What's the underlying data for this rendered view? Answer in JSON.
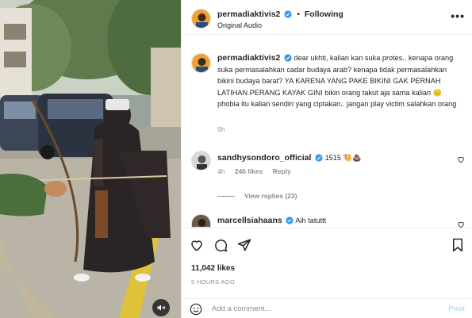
{
  "post": {
    "author": "permadiaktivis2",
    "follow_state": "Following",
    "audio_label": "Original Audio",
    "more_label": "•••",
    "caption_author": "permadiaktivis2",
    "caption_text": "dear ukhti, kalian kan suka protes.. kenapa orang suka permasalahkan cadar budaya arab? kenapa tidak permasalahkan bikini budaya barat? YA KARENA YANG PAKE BIKINI GAK PERNAH LATIHAN PERANG KAYAK GINI bikin orang takut aja sama kalian 😑 phobia itu kalian sendiri yang ciptakan.. jangan play victim salahkan orang",
    "caption_time": "5h",
    "likes": "11,042 likes",
    "posted_ago": "5 HOURS AGO"
  },
  "comments": [
    {
      "author": "sandhysondoro_official",
      "text": "1515 🐫💩",
      "time": "4h",
      "likes": "246 likes",
      "reply_label": "Reply",
      "view_replies": "View replies (23)"
    },
    {
      "author": "marcellsiahaans",
      "text": "Aih tatuttt"
    }
  ],
  "comment_bar": {
    "placeholder": "Add a comment...",
    "post_label": "Post"
  },
  "icons": {
    "verified": "verified-badge-icon",
    "like": "heart-icon",
    "comment": "comment-bubble-icon",
    "share": "paper-plane-icon",
    "save": "bookmark-icon",
    "emoji": "smiley-icon",
    "mute": "speaker-muted-icon"
  },
  "colors": {
    "verified_blue": "#3897f0",
    "text_primary": "#262626",
    "text_muted": "#8e8e8e",
    "post_button": "#b2dffc"
  }
}
